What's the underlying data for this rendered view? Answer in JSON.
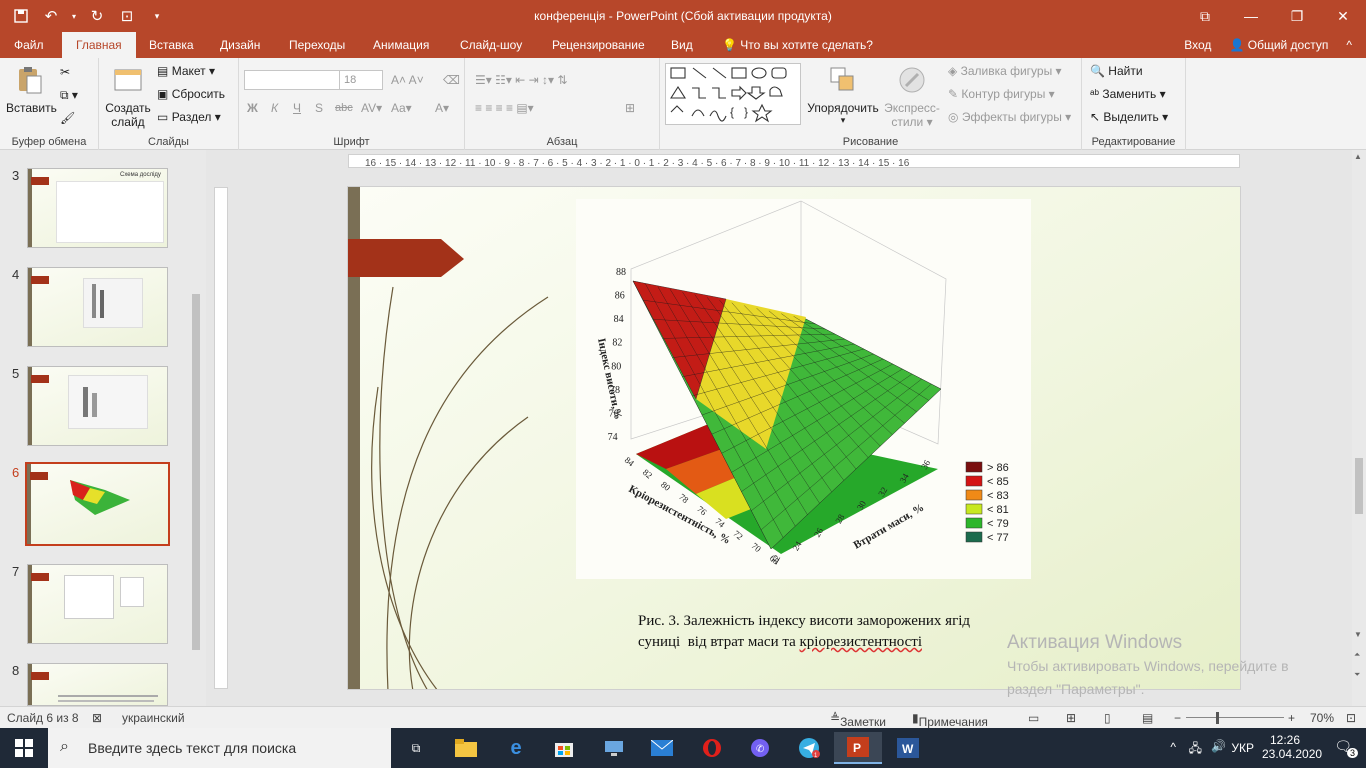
{
  "window": {
    "title": "конференція - PowerPoint (Сбой активации продукта)"
  },
  "tabs": [
    {
      "label": "Файл"
    },
    {
      "label": "Главная"
    },
    {
      "label": "Вставка"
    },
    {
      "label": "Дизайн"
    },
    {
      "label": "Переходы"
    },
    {
      "label": "Анимация"
    },
    {
      "label": "Слайд-шоу"
    },
    {
      "label": "Рецензирование"
    },
    {
      "label": "Вид"
    },
    {
      "label": "Что вы хотите сделать?"
    }
  ],
  "account": {
    "signin": "Вход",
    "share": "Общий доступ"
  },
  "ribbon": {
    "clipboard": {
      "paste": "Вставить",
      "group": "Буфер обмена"
    },
    "slides": {
      "new_slide_1": "Создать",
      "new_slide_2": "слайд",
      "layout": "Макет",
      "reset": "Сбросить",
      "section": "Раздел",
      "group": "Слайды"
    },
    "font": {
      "size": "18",
      "bold": "Ж",
      "italic": "К",
      "underline": "Ч",
      "strike": "S",
      "spacing": "abc",
      "group": "Шрифт"
    },
    "paragraph": {
      "group": "Абзац"
    },
    "drawing": {
      "arrange": "Упорядочить",
      "styles_1": "Экспресс-",
      "styles_2": "стили",
      "fill": "Заливка фигуры",
      "outline": "Контур фигуры",
      "effects": "Эффекты фигуры",
      "group": "Рисование"
    },
    "editing": {
      "find": "Найти",
      "replace": "Заменить",
      "select": "Выделить",
      "group": "Редактирование"
    }
  },
  "thumbnails": [
    {
      "num": "3",
      "title": "Схема досліду"
    },
    {
      "num": "4"
    },
    {
      "num": "5"
    },
    {
      "num": "6"
    },
    {
      "num": "7"
    },
    {
      "num": "8"
    }
  ],
  "slide": {
    "caption_line1": "Рис. 3. Залежність індексу висоти заморожених ягід",
    "caption_line2_a": "суниці  від втрат маси та ",
    "caption_line2_b": "кріорезистентності"
  },
  "chart_data": {
    "type": "surface3d",
    "z_axis_label": "Індекс висоти,%",
    "z_ticks": [
      "88",
      "86",
      "84",
      "82",
      "80",
      "78",
      "76",
      "74"
    ],
    "x_axis_label": "Кріорезистентність, %",
    "x_ticks": [
      "84",
      "82",
      "80",
      "78",
      "76",
      "74",
      "72",
      "70",
      "68"
    ],
    "y_axis_label": "Втрати маси, %",
    "y_ticks": [
      "22",
      "24",
      "26",
      "28",
      "30",
      "32",
      "34",
      "36"
    ],
    "legend": [
      {
        "label": "> 86",
        "color": "#7a0f0f"
      },
      {
        "label": "< 85",
        "color": "#d41414"
      },
      {
        "label": "< 83",
        "color": "#f08a17"
      },
      {
        "label": "< 81",
        "color": "#c7e81f"
      },
      {
        "label": "< 79",
        "color": "#2db62a"
      },
      {
        "label": "< 77",
        "color": "#1c6b4d"
      }
    ]
  },
  "activation": {
    "title": "Активация Windows",
    "line1": "Чтобы активировать Windows, перейдите в",
    "line2": "раздел \"Параметры\"."
  },
  "status": {
    "slide": "Слайд 6 из 8",
    "lang": "украинский",
    "notes": "Заметки",
    "comments": "Примечания",
    "zoom": "70%"
  },
  "taskbar": {
    "search_placeholder": "Введите здесь текст для поиска",
    "lang": "УКР",
    "time": "12:26",
    "date": "23.04.2020",
    "notif": "3"
  }
}
